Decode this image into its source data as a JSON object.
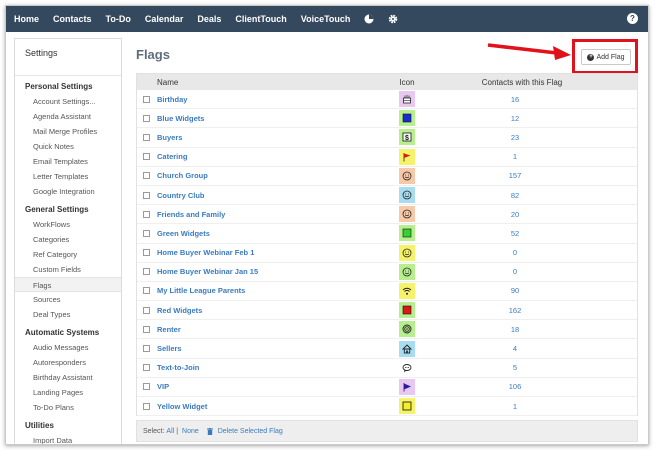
{
  "nav": {
    "items": [
      "Home",
      "Contacts",
      "To-Do",
      "Calendar",
      "Deals",
      "ClientTouch",
      "VoiceTouch"
    ],
    "icons": [
      "pie-chart-icon",
      "gear-icon"
    ],
    "help_icon": "help-icon",
    "help_glyph": "?"
  },
  "sidebar": {
    "title": "Settings",
    "sections": [
      {
        "label": "Personal Settings",
        "items": [
          "Account Settings...",
          "Agenda Assistant",
          "Mail Merge Profiles",
          "Quick Notes",
          "Email Templates",
          "Letter Templates",
          "Google Integration"
        ]
      },
      {
        "label": "General Settings",
        "items": [
          "WorkFlows",
          "Categories",
          "Ref Category",
          "Custom Fields",
          "Flags",
          "Sources",
          "Deal Types"
        ]
      },
      {
        "label": "Automatic Systems",
        "items": [
          "Audio Messages",
          "Autoresponders",
          "Birthday Assistant",
          "Landing Pages",
          "To-Do Plans"
        ]
      },
      {
        "label": "Utilities",
        "items": [
          "Import Data"
        ]
      }
    ],
    "active_item": "Flags"
  },
  "main": {
    "title": "Flags",
    "add_flag_label": "Add Flag",
    "columns": {
      "name": "Name",
      "icon": "Icon",
      "contacts": "Contacts with this Flag"
    },
    "flags": [
      {
        "name": "Birthday",
        "icon": "cake-icon",
        "bg": "#e8c8f0",
        "count": "16"
      },
      {
        "name": "Blue Widgets",
        "icon": "blue-square-icon",
        "bg": "#b7ee8e",
        "count": "12"
      },
      {
        "name": "Buyers",
        "icon": "dollar-icon",
        "bg": "#b7ee8e",
        "count": "23"
      },
      {
        "name": "Catering",
        "icon": "red-flag-icon",
        "bg": "#f5f36a",
        "count": "1"
      },
      {
        "name": "Church Group",
        "icon": "smiley-icon",
        "bg": "#f8c9a8",
        "count": "157"
      },
      {
        "name": "Country Club",
        "icon": "smiley-icon",
        "bg": "#a8dcf0",
        "count": "82"
      },
      {
        "name": "Friends and Family",
        "icon": "smiley-icon",
        "bg": "#f8c9a8",
        "count": "20"
      },
      {
        "name": "Green Widgets",
        "icon": "green-square-icon",
        "bg": "#b7ee8e",
        "count": "52"
      },
      {
        "name": "Home Buyer Webinar Feb 1",
        "icon": "smiley-icon",
        "bg": "#f5f36a",
        "count": "0"
      },
      {
        "name": "Home Buyer Webinar Jan 15",
        "icon": "smiley-icon",
        "bg": "#b7ee8e",
        "count": "0"
      },
      {
        "name": "My Little League Parents",
        "icon": "wifi-icon",
        "bg": "#f5f36a",
        "count": "90"
      },
      {
        "name": "Red Widgets",
        "icon": "red-square-icon",
        "bg": "#b7ee8e",
        "count": "162"
      },
      {
        "name": "Renter",
        "icon": "target-icon",
        "bg": "#b7ee8e",
        "count": "18"
      },
      {
        "name": "Sellers",
        "icon": "house-icon",
        "bg": "#a8dcf0",
        "count": "4"
      },
      {
        "name": "Text-to-Join",
        "icon": "chat-icon",
        "bg": "#ffffff",
        "count": "5"
      },
      {
        "name": "VIP",
        "icon": "flag-icon",
        "bg": "#e8c8f0",
        "count": "106"
      },
      {
        "name": "Yellow Widget",
        "icon": "yellow-square-icon",
        "bg": "#f5f36a",
        "count": "1"
      }
    ],
    "footer": {
      "select_label": "Select:",
      "all": "All",
      "none": "None",
      "separator": "|",
      "delete_label": "Delete Selected Flag"
    }
  }
}
